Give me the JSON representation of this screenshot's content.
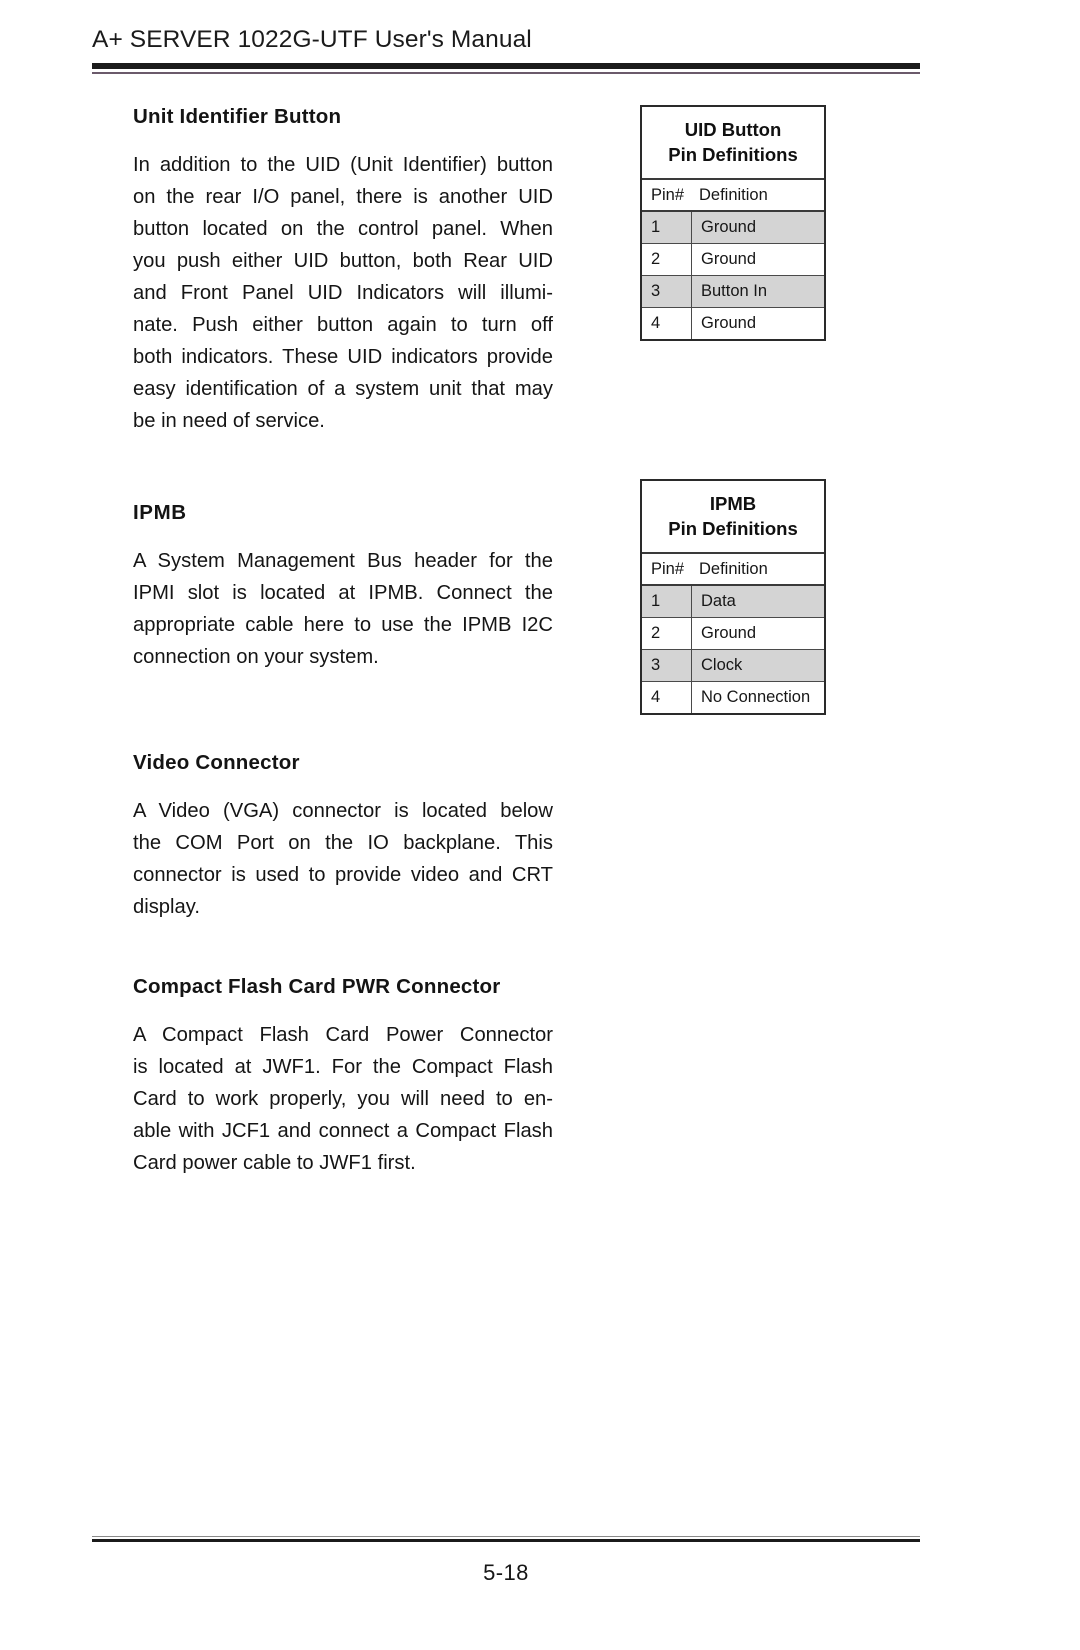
{
  "header": {
    "title": "A+ SERVER 1022G-UTF User's Manual"
  },
  "sections": [
    {
      "heading": "Unit Identifier Button",
      "lines": [
        "In addition to the UID (Unit Identifier) button",
        "on the rear I/O panel, there is another UID",
        "button located on the control panel. When",
        "you push either UID button, both Rear UID",
        "and Front Panel UID Indicators will illumi-",
        "nate. Push either button again to turn off",
        "both indicators. These UID indicators provide",
        "easy identification of a system unit that may",
        "be in need of service."
      ]
    },
    {
      "heading": "IPMB",
      "lines": [
        "A System Management Bus header for the",
        "IPMI slot is located at IPMB. Connect the",
        "appropriate cable here to use the IPMB I2C",
        "connection on your system."
      ]
    },
    {
      "heading": "Video Connector",
      "lines": [
        "A Video (VGA) connector is located below",
        "the COM Port on the IO backplane. This",
        "connector is used to provide video and CRT",
        "display."
      ]
    },
    {
      "heading": "Compact Flash Card PWR Connector",
      "lines": [
        "A Compact Flash Card Power Connector",
        "is located at JWF1. For the Compact Flash",
        "Card to work properly, you will need to en-",
        "able with JCF1 and connect a Compact Flash",
        "Card power cable to JWF1 first."
      ]
    }
  ],
  "tables": [
    {
      "title_line1": "UID Button",
      "title_line2": "Pin Definitions",
      "columns": [
        "Pin#",
        "Definition"
      ],
      "rows": [
        {
          "pin": "1",
          "definition": "Ground",
          "shaded": true
        },
        {
          "pin": "2",
          "definition": "Ground",
          "shaded": false
        },
        {
          "pin": "3",
          "definition": "Button In",
          "shaded": true
        },
        {
          "pin": "4",
          "definition": "Ground",
          "shaded": false
        }
      ]
    },
    {
      "title_line1": "IPMB",
      "title_line2": "Pin Definitions",
      "columns": [
        "Pin#",
        "Definition"
      ],
      "rows": [
        {
          "pin": "1",
          "definition": "Data",
          "shaded": true
        },
        {
          "pin": "2",
          "definition": "Ground",
          "shaded": false
        },
        {
          "pin": "3",
          "definition": "Clock",
          "shaded": true
        },
        {
          "pin": "4",
          "definition": "No Connection",
          "shaded": false
        }
      ]
    }
  ],
  "footer": {
    "page_number": "5-18"
  },
  "colors": {
    "shaded_row": "#d4d4d4",
    "rule": "#1b1b1b",
    "text": "#151515"
  }
}
